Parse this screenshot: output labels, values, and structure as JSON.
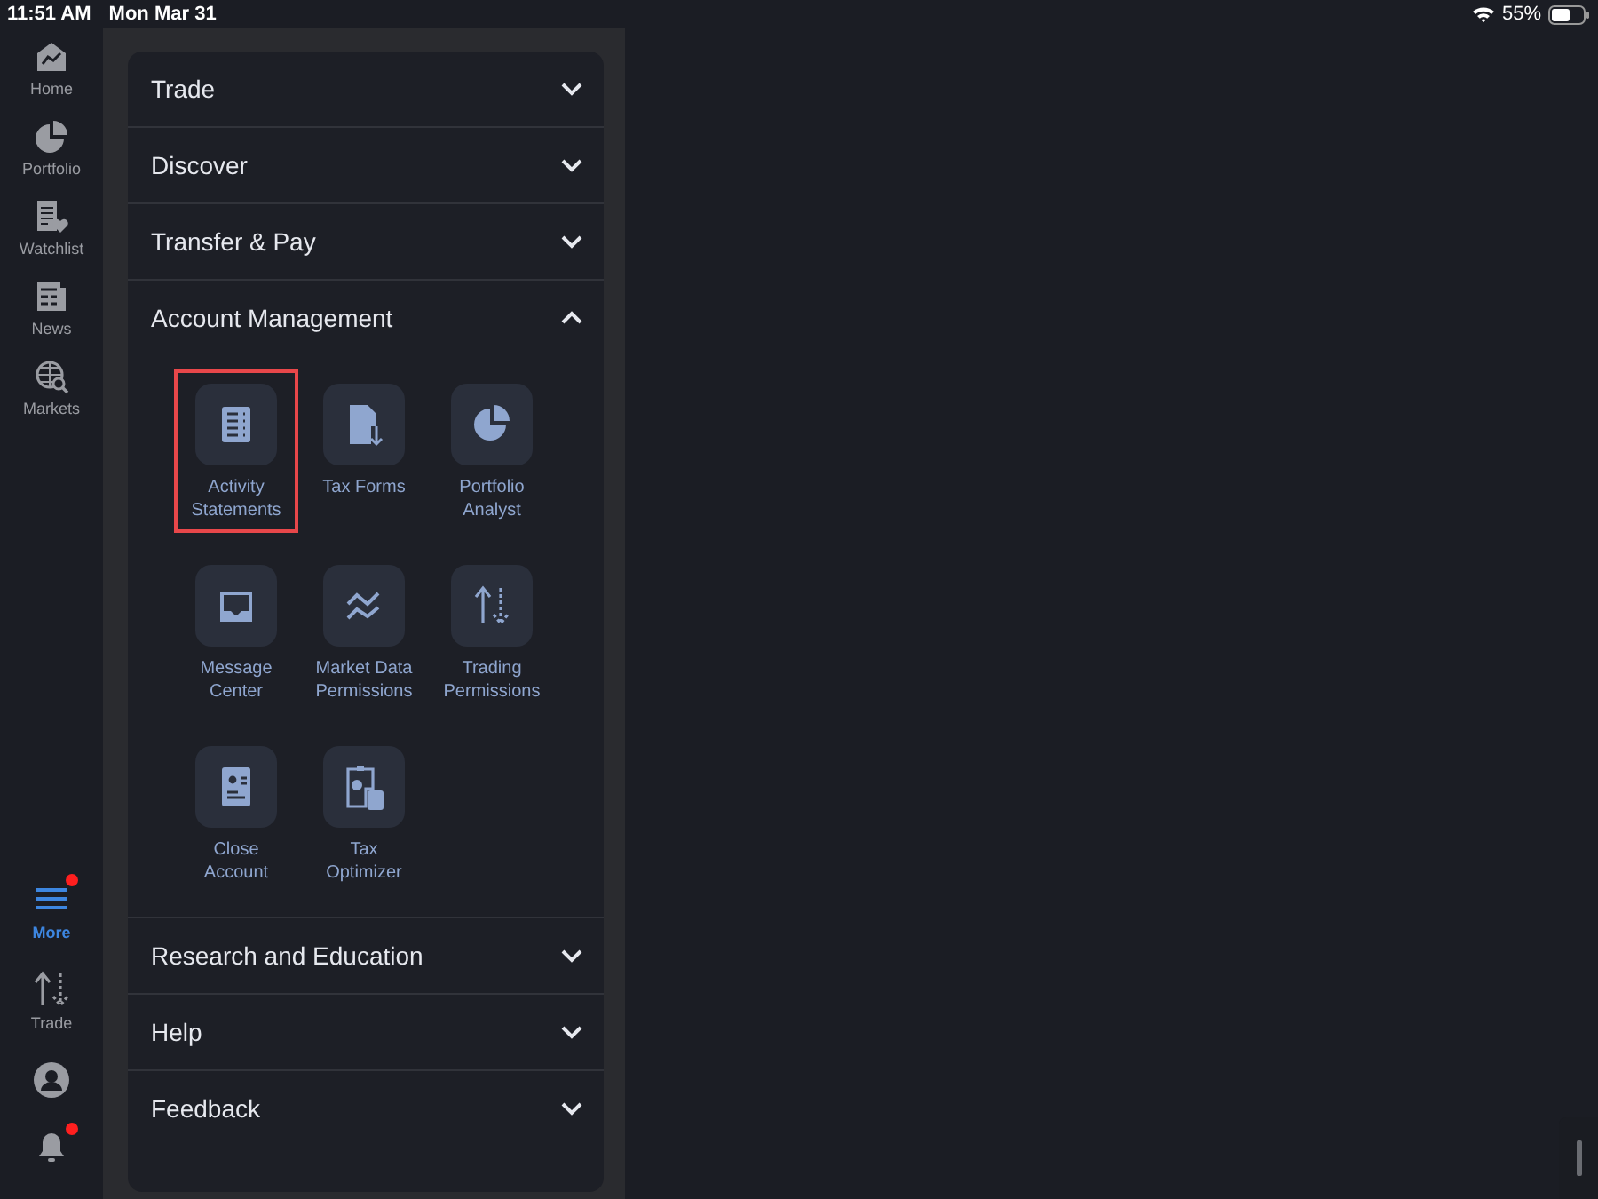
{
  "status_bar": {
    "time": "11:51 AM",
    "date": "Mon Mar 31",
    "battery": "55%"
  },
  "sidebar": {
    "items": [
      {
        "kind": "home",
        "label": "Home",
        "selected": false
      },
      {
        "kind": "portfolio",
        "label": "Portfolio",
        "selected": false
      },
      {
        "kind": "watchlist",
        "label": "Watchlist",
        "selected": false
      },
      {
        "kind": "news",
        "label": "News",
        "selected": false
      },
      {
        "kind": "markets",
        "label": "Markets",
        "selected": false
      }
    ],
    "bottom_items": [
      {
        "kind": "more",
        "label": "More",
        "selected": true,
        "badge": true
      },
      {
        "kind": "trade",
        "label": "Trade",
        "selected": false,
        "badge": false
      },
      {
        "kind": "profile",
        "selected": false,
        "badge": false
      },
      {
        "kind": "bell",
        "selected": false,
        "badge": true
      }
    ]
  },
  "sections": [
    {
      "title": "Trade",
      "expanded": false
    },
    {
      "title": "Discover",
      "expanded": false
    },
    {
      "title": "Transfer & Pay",
      "expanded": false
    },
    {
      "title": "Account Management",
      "expanded": true,
      "tiles": [
        {
          "kind": "statement",
          "label": "Activity Statements",
          "highlighted": true
        },
        {
          "kind": "tax-form",
          "label": "Tax Forms",
          "highlighted": false
        },
        {
          "kind": "pie",
          "label": "Portfolio Analyst",
          "highlighted": false
        },
        {
          "kind": "inbox",
          "label": "Message Center",
          "highlighted": false
        },
        {
          "kind": "chart",
          "label": "Market Data Permissions",
          "highlighted": false
        },
        {
          "kind": "arrows",
          "label": "Trading Permissions",
          "highlighted": false
        },
        {
          "kind": "id-card",
          "label": "Close Account",
          "highlighted": false
        },
        {
          "kind": "calculator",
          "label": "Tax Optimizer",
          "highlighted": false
        }
      ]
    },
    {
      "title": "Research and Education",
      "expanded": false
    },
    {
      "title": "Help",
      "expanded": false
    },
    {
      "title": "Feedback",
      "expanded": false
    }
  ]
}
